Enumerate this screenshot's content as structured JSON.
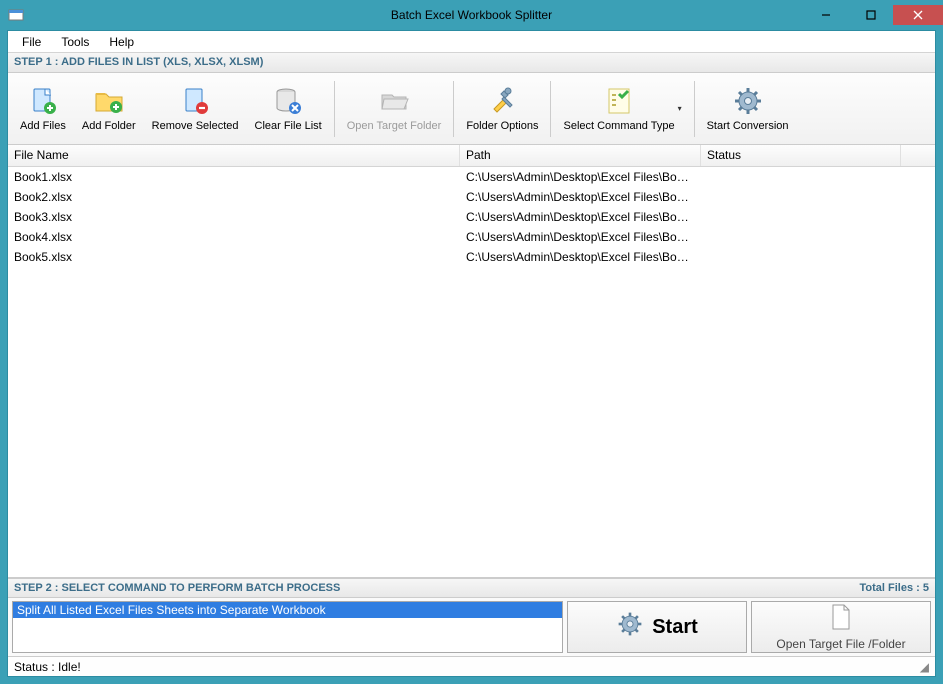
{
  "window": {
    "title": "Batch Excel Workbook Splitter"
  },
  "menu": {
    "file": "File",
    "tools": "Tools",
    "help": "Help"
  },
  "step1_header": "STEP 1 : ADD FILES IN LIST (XLS, XLSX, XLSM)",
  "toolbar": {
    "add_files": "Add Files",
    "add_folder": "Add Folder",
    "remove_selected": "Remove Selected",
    "clear_list": "Clear File List",
    "open_target": "Open Target Folder",
    "folder_options": "Folder Options",
    "select_command": "Select Command Type",
    "start_conversion": "Start Conversion"
  },
  "grid": {
    "headers": {
      "name": "File Name",
      "path": "Path",
      "status": "Status"
    },
    "rows": [
      {
        "name": "Book1.xlsx",
        "path": "C:\\Users\\Admin\\Desktop\\Excel Files\\Book...",
        "status": ""
      },
      {
        "name": "Book2.xlsx",
        "path": "C:\\Users\\Admin\\Desktop\\Excel Files\\Book...",
        "status": ""
      },
      {
        "name": "Book3.xlsx",
        "path": "C:\\Users\\Admin\\Desktop\\Excel Files\\Book...",
        "status": ""
      },
      {
        "name": "Book4.xlsx",
        "path": "C:\\Users\\Admin\\Desktop\\Excel Files\\Book...",
        "status": ""
      },
      {
        "name": "Book5.xlsx",
        "path": "C:\\Users\\Admin\\Desktop\\Excel Files\\Book...",
        "status": ""
      }
    ]
  },
  "step2_header": "STEP 2 : SELECT COMMAND TO PERFORM BATCH PROCESS",
  "total_files": "Total Files : 5",
  "command_selected": "Split All Listed Excel Files Sheets into Separate Workbook",
  "start_button": "Start",
  "open_target_button": "Open Target File /Folder",
  "status_text": "Status  :  Idle!"
}
